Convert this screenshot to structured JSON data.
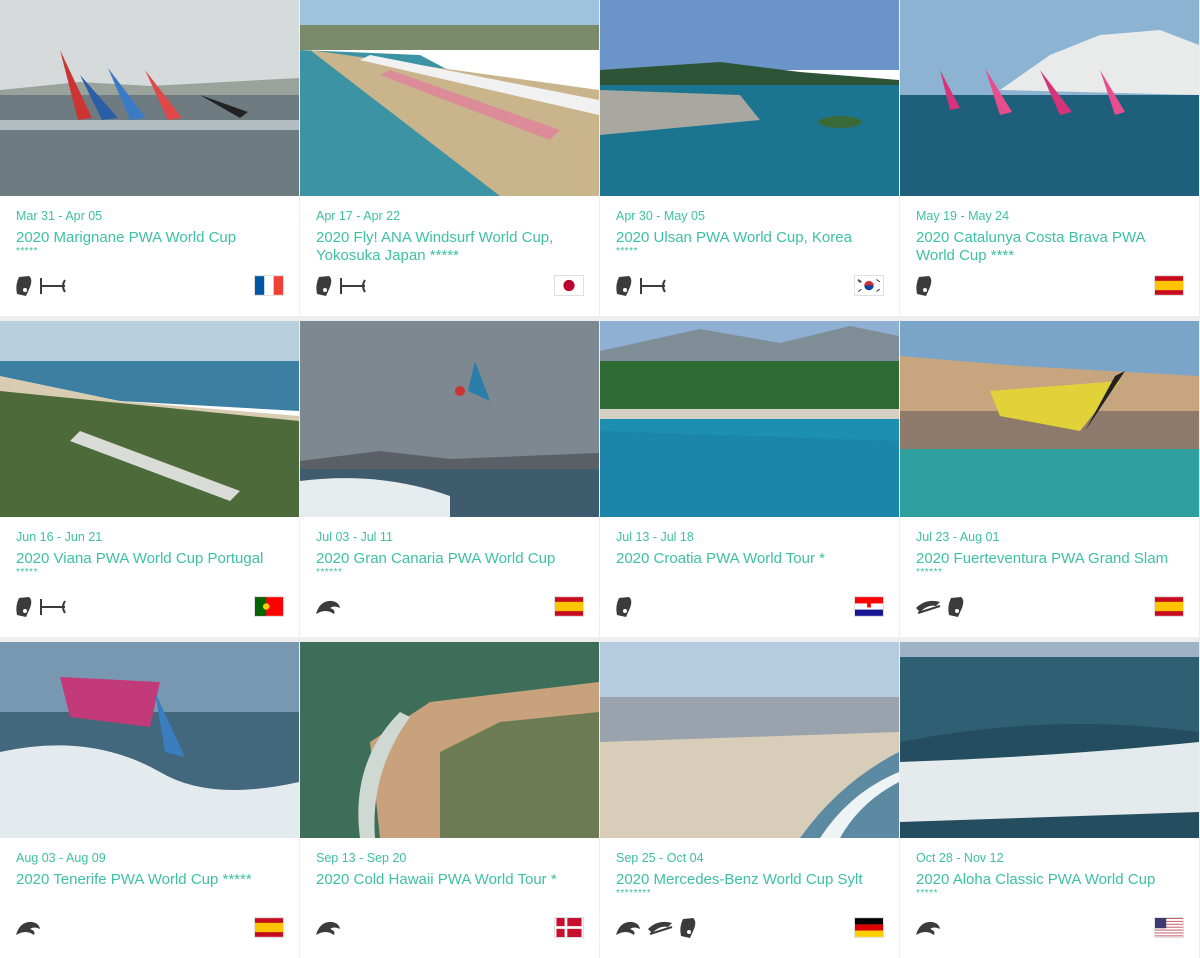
{
  "events": [
    {
      "dates": "Mar 31 - Apr 05",
      "title": "2020 Marignane PWA World Cup",
      "stars": "*****",
      "disciplines": [
        "slalom",
        "foil"
      ],
      "flag": "fr",
      "scene": "sailboats",
      "colors": {
        "sky": "#d7dadb",
        "water": "#6e7c82"
      }
    },
    {
      "dates": "Apr 17 - Apr 22",
      "title": "2020 Fly! ANA Windsurf World Cup, Yokosuka Japan *****",
      "stars": "",
      "disciplines": [
        "slalom",
        "foil"
      ],
      "flag": "jp",
      "scene": "beach",
      "colors": {
        "sky": "#9ec4dd",
        "water": "#3c93a3"
      }
    },
    {
      "dates": "Apr 30 - May 05",
      "title": "2020 Ulsan PWA World Cup, Korea",
      "stars": "*****",
      "disciplines": [
        "slalom",
        "foil"
      ],
      "flag": "kr",
      "scene": "bay",
      "colors": {
        "sky": "#6b95c8",
        "water": "#1b7591"
      }
    },
    {
      "dates": "May 19 - May 24",
      "title": "2020 Catalunya Costa Brava PWA World Cup ****",
      "stars": "",
      "disciplines": [
        "slalom"
      ],
      "flag": "es",
      "scene": "townsails",
      "colors": {
        "sky": "#8cb3d2",
        "water": "#1e5f7b"
      }
    },
    {
      "dates": "Jun 16 - Jun 21",
      "title": "2020 Viana PWA World Cup Portugal",
      "stars": "*****",
      "disciplines": [
        "slalom",
        "foil"
      ],
      "flag": "pt",
      "scene": "forest",
      "colors": {
        "sky": "#b8cfde",
        "water": "#3d7fa3"
      }
    },
    {
      "dates": "Jul 03 - Jul 11",
      "title": "2020 Gran Canaria PWA World Cup",
      "stars": "******",
      "disciplines": [
        "wave"
      ],
      "flag": "es",
      "scene": "jump",
      "colors": {
        "sky": "#7d8890",
        "water": "#3e5c6e"
      }
    },
    {
      "dates": "Jul 13 - Jul 18",
      "title": "2020 Croatia PWA World Tour *",
      "stars": "",
      "disciplines": [
        "slalom"
      ],
      "flag": "hr",
      "scene": "lagoon",
      "colors": {
        "sky": "#8fb0d3",
        "water": "#1d8fb0"
      }
    },
    {
      "dates": "Jul 23 - Aug 01",
      "title": "2020 Fuerteventura PWA Grand Slam",
      "stars": "******",
      "disciplines": [
        "freestyle",
        "slalom"
      ],
      "flag": "es",
      "scene": "bigsail",
      "colors": {
        "sky": "#7aa4c8",
        "water": "#2f9fa0"
      }
    },
    {
      "dates": "Aug 03 - Aug 09",
      "title": "2020 Tenerife PWA World Cup *****",
      "stars": "",
      "disciplines": [
        "wave"
      ],
      "flag": "es",
      "scene": "wavesail",
      "colors": {
        "sky": "#7898b2",
        "water": "#43677c"
      }
    },
    {
      "dates": "Sep 13 - Sep 20",
      "title": "2020 Cold Hawaii PWA World Tour *",
      "stars": "",
      "disciplines": [
        "wave"
      ],
      "flag": "dk",
      "scene": "coast",
      "colors": {
        "sky": "#3c6e5a",
        "water": "#2d5c4c"
      }
    },
    {
      "dates": "Sep 25 - Oct 04",
      "title": "2020 Mercedes-Benz World Cup Sylt",
      "stars": "********",
      "disciplines": [
        "wave",
        "freestyle",
        "slalom"
      ],
      "flag": "de",
      "scene": "crowd",
      "colors": {
        "sky": "#b4cbe0",
        "water": "#5c8aa2"
      }
    },
    {
      "dates": "Oct 28 - Nov 12",
      "title": "2020 Aloha Classic PWA World Cup",
      "stars": "*****",
      "disciplines": [
        "wave"
      ],
      "flag": "us",
      "scene": "ocean",
      "colors": {
        "sky": "#9eb4c6",
        "water": "#2f5f73"
      }
    }
  ]
}
